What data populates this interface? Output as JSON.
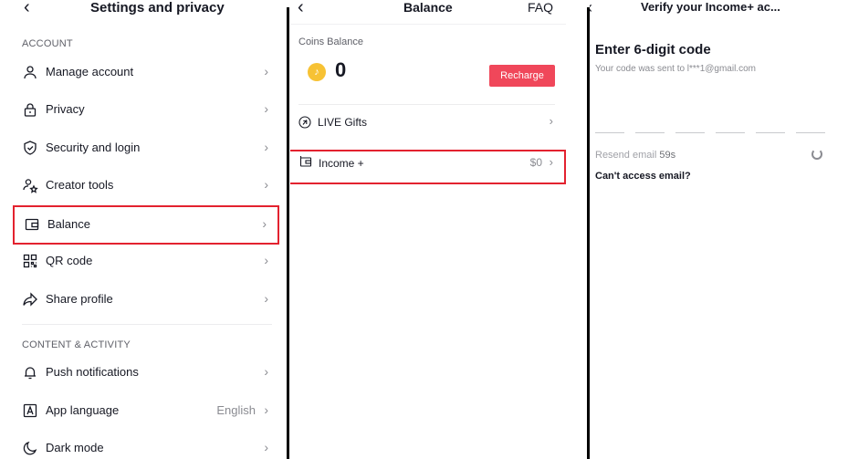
{
  "settings": {
    "title": "Settings and privacy",
    "account_header": "ACCOUNT",
    "items": [
      {
        "label": "Manage account",
        "icon": "person-icon"
      },
      {
        "label": "Privacy",
        "icon": "lock-icon"
      },
      {
        "label": "Security and login",
        "icon": "shield-icon"
      },
      {
        "label": "Creator tools",
        "icon": "creator-tools-icon"
      },
      {
        "label": "Balance",
        "icon": "wallet-icon"
      },
      {
        "label": "QR code",
        "icon": "qr-code-icon"
      },
      {
        "label": "Share profile",
        "icon": "share-icon"
      }
    ],
    "content_header": "CONTENT & ACTIVITY",
    "items2": [
      {
        "label": "Push notifications",
        "icon": "bell-icon"
      },
      {
        "label": "App language",
        "icon": "language-icon",
        "value": "English"
      },
      {
        "label": "Dark mode",
        "icon": "moon-icon"
      }
    ]
  },
  "balance": {
    "title": "Balance",
    "faq": "FAQ",
    "coins_label": "Coins Balance",
    "coins_value": "0",
    "coin_badge": "♪",
    "recharge": "Recharge",
    "live_gifts": "LIVE Gifts",
    "income_label": "Income +",
    "income_value": "$0"
  },
  "verify": {
    "title": "Verify your Income+ ac...",
    "heading": "Enter 6-digit code",
    "subtitle": "Your code was sent to l***1@gmail.com",
    "resend_prefix": "Resend email",
    "resend_timer": "59s",
    "cant_access": "Can't access email?"
  },
  "common": {
    "back": "‹",
    "chevron": "›"
  },
  "colors": {
    "highlight": "#e3222f",
    "recharge": "#f0475a",
    "coin": "#f7c234"
  }
}
